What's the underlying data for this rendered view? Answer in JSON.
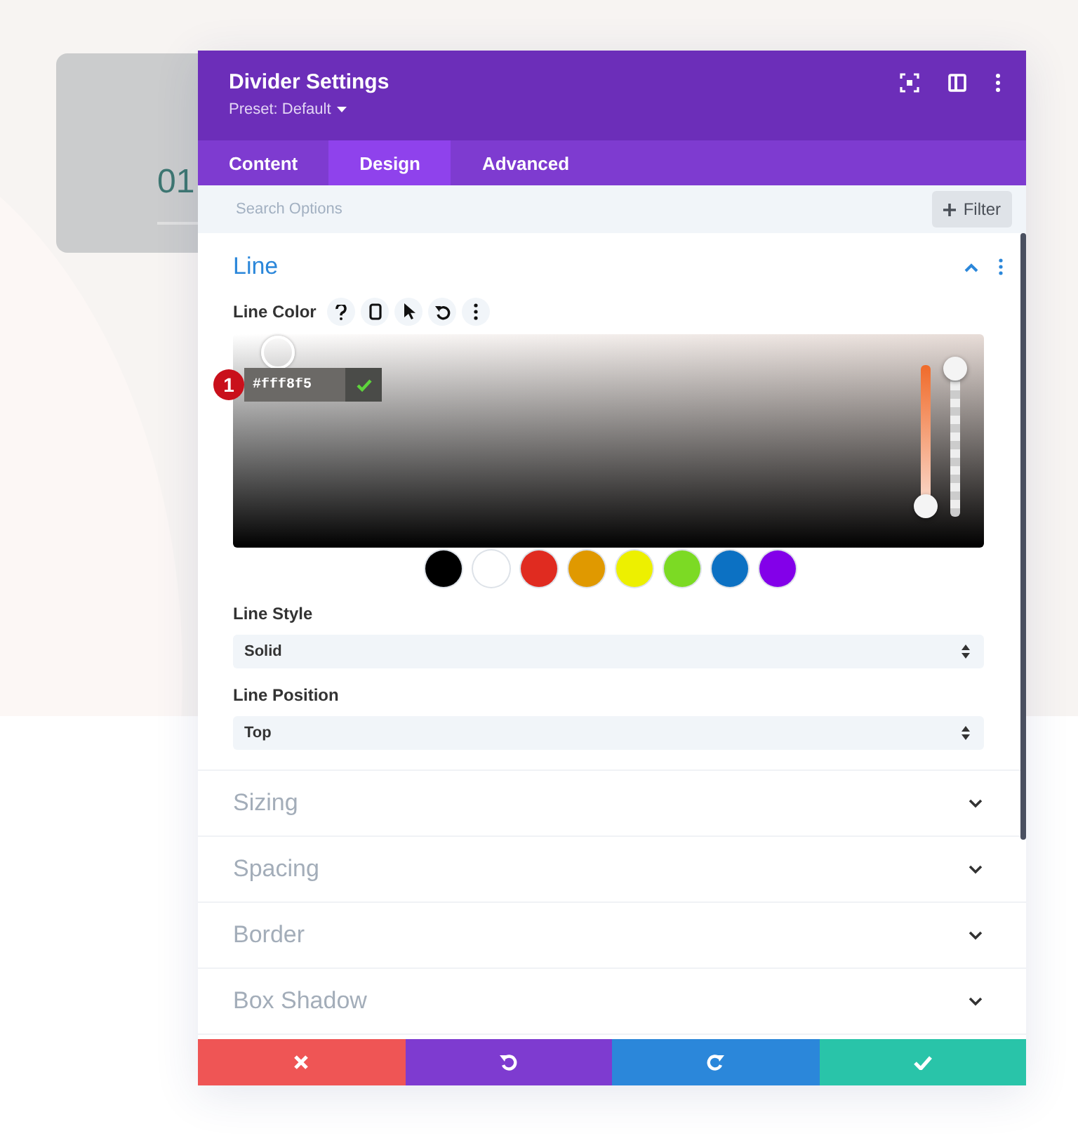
{
  "background_card": {
    "number": "01"
  },
  "modal": {
    "title": "Divider Settings",
    "preset": "Preset: Default",
    "tabs": [
      {
        "label": "Content",
        "selected": false
      },
      {
        "label": "Design",
        "selected": true
      },
      {
        "label": "Advanced",
        "selected": false
      }
    ],
    "search": {
      "placeholder": "Search Options"
    },
    "filter_button": "Filter",
    "open_section": {
      "title": "Line",
      "expanded": true,
      "color_field": {
        "label": "Line Color",
        "marker": "1",
        "hex": "#fff8f5",
        "sliders": [
          {
            "kind": "hue",
            "level": 0.05
          },
          {
            "kind": "opacity",
            "level": 1
          }
        ],
        "swatches": [
          {
            "color": "#000000"
          },
          {
            "color": "#ffffff"
          },
          {
            "color": "#e02b20"
          },
          {
            "color": "#e09900"
          },
          {
            "color": "#edf000"
          },
          {
            "color": "#7cda24"
          },
          {
            "color": "#0c71c3"
          },
          {
            "color": "#8300e9"
          }
        ]
      },
      "selects": [
        {
          "label": "Line Style",
          "value": "Solid"
        },
        {
          "label": "Line Position",
          "value": "Top"
        }
      ]
    },
    "sections": [
      {
        "title": "Sizing",
        "expanded": false
      },
      {
        "title": "Spacing",
        "expanded": false
      },
      {
        "title": "Border",
        "expanded": false
      },
      {
        "title": "Box Shadow",
        "expanded": false
      }
    ],
    "footer_buttons": [
      {
        "kind": "cancel"
      },
      {
        "kind": "undo"
      },
      {
        "kind": "redo"
      },
      {
        "kind": "save"
      }
    ]
  }
}
